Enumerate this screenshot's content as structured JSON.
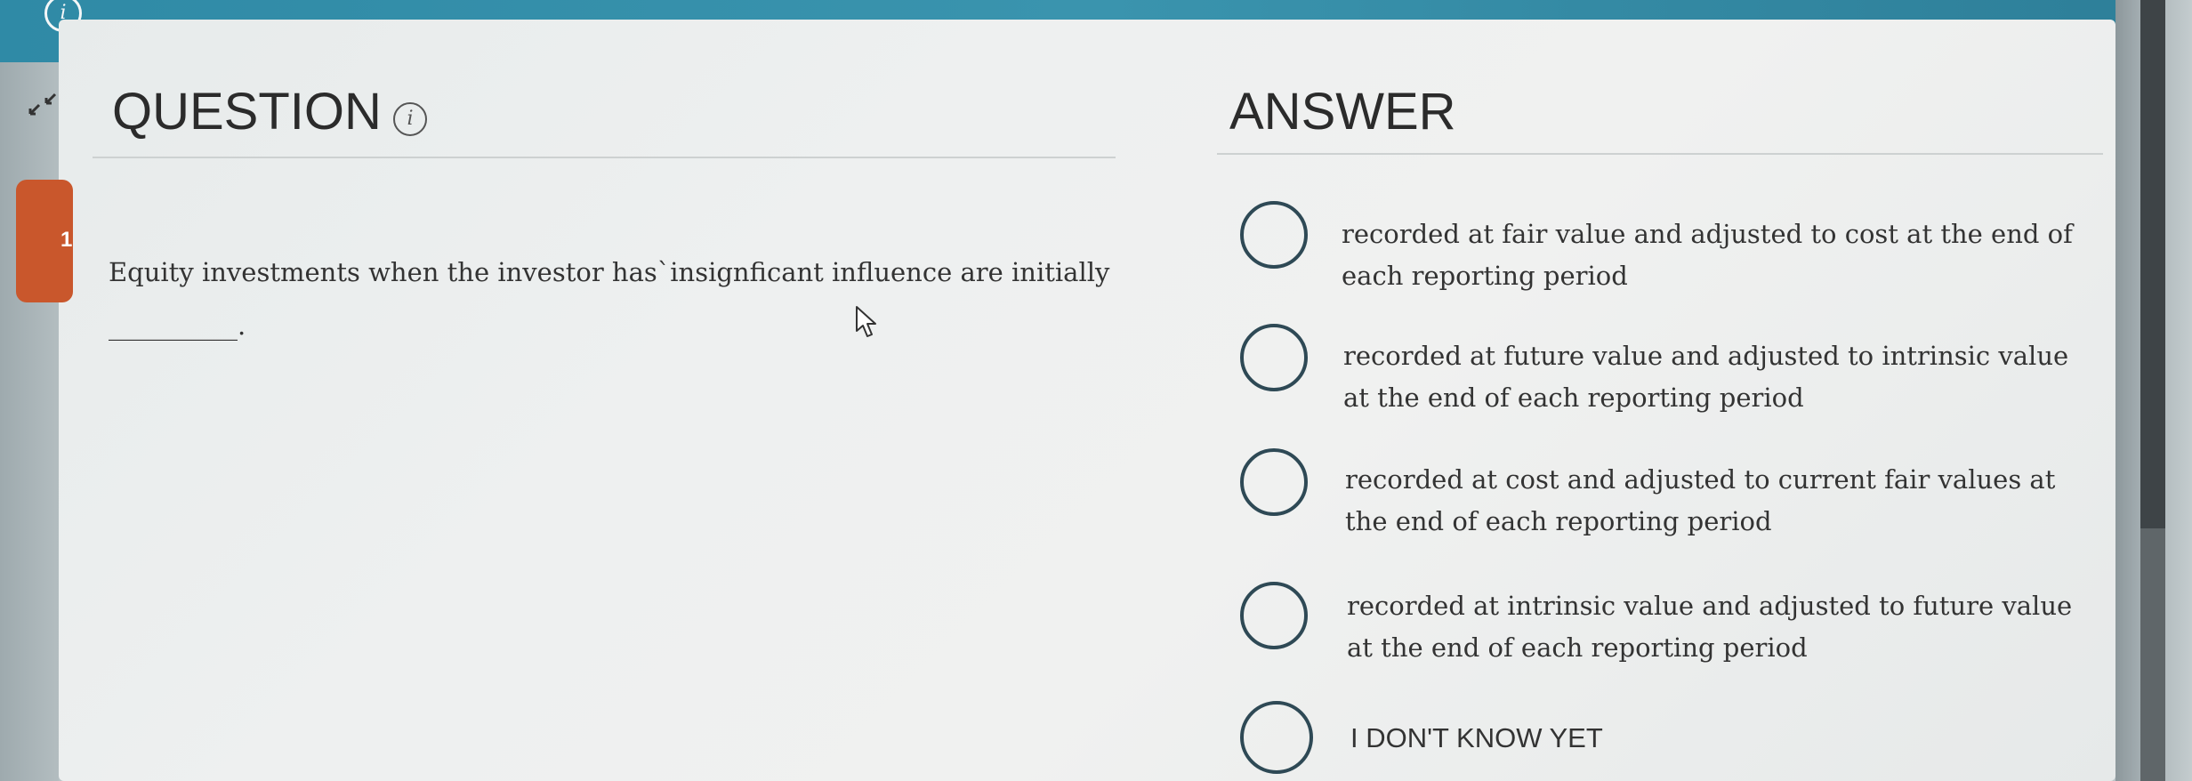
{
  "question": {
    "title": "QUESTION",
    "tab_number": "1",
    "text": "Equity investments when the investor has`insignficant influence are initially",
    "blank": "__________."
  },
  "answer": {
    "title": "ANSWER",
    "options": [
      {
        "label": "recorded at fair value and adjusted to cost at the end of each reporting period"
      },
      {
        "label": "recorded at future value and adjusted to intrinsic value at the end of each reporting period"
      },
      {
        "label": "recorded at cost and adjusted to current fair values at the end of each reporting period"
      },
      {
        "label": "recorded at intrinsic value and adjusted to future value at the end of each reporting period"
      },
      {
        "label": "I DON'T KNOW YET"
      }
    ]
  },
  "icons": {
    "top_info": "info-icon",
    "collapse": "collapse-arrows-icon",
    "question_info": "info-icon",
    "cursor": "mouse-pointer-icon"
  },
  "colors": {
    "header_teal": "#3a94ae",
    "question_tab": "#c9572c",
    "radio_border": "#2e4955",
    "text": "#333333"
  }
}
